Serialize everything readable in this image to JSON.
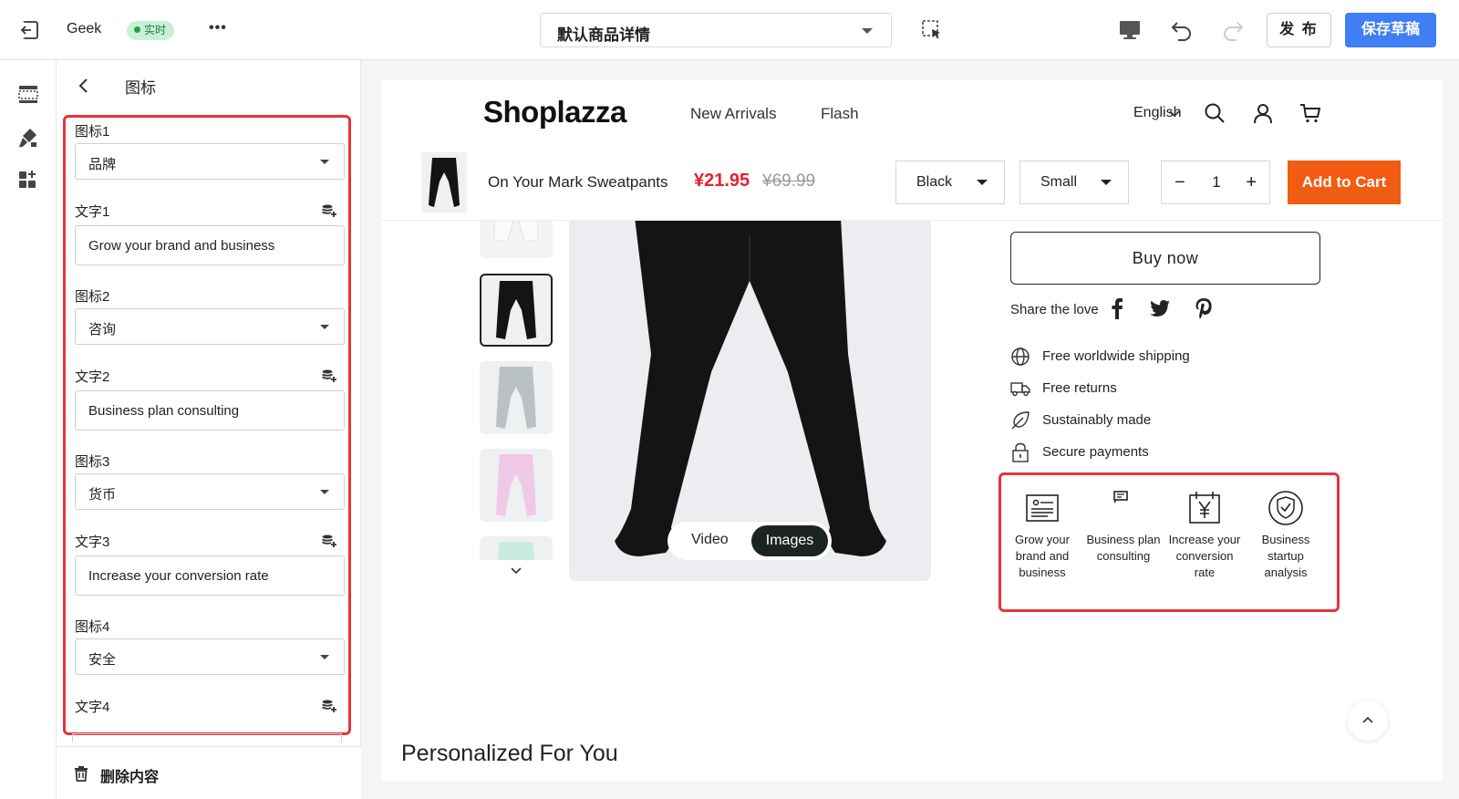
{
  "topbar": {
    "store_name": "Geek",
    "status_badge": "实时",
    "more": "•••",
    "page_select": "默认商品详情",
    "publish_label": "发 布",
    "save_label": "保存草稿"
  },
  "panel": {
    "title": "图标",
    "fields": [
      {
        "icon_label": "图标1",
        "icon_value": "品牌",
        "text_label": "文字1",
        "text_value": "Grow your brand and business"
      },
      {
        "icon_label": "图标2",
        "icon_value": "咨询",
        "text_label": "文字2",
        "text_value": "Business plan consulting"
      },
      {
        "icon_label": "图标3",
        "icon_value": "货币",
        "text_label": "文字3",
        "text_value": "Increase your conversion rate"
      },
      {
        "icon_label": "图标4",
        "icon_value": "安全",
        "text_label": "文字4"
      }
    ],
    "delete_label": "删除内容"
  },
  "preview": {
    "logo": "Shoplazza",
    "nav": [
      "New Arrivals",
      "Flash"
    ],
    "language": "English",
    "sticky": {
      "product_name": "On Your Mark Sweatpants",
      "price": "¥21.95",
      "old_price": "¥69.99",
      "color": "Black",
      "size": "Small",
      "quantity": "1",
      "minus": "−",
      "plus": "+",
      "add_to_cart": "Add to Cart"
    },
    "media_toggle": [
      "Video",
      "Images"
    ],
    "buy_now": "Buy now",
    "share_label": "Share the love",
    "features": [
      "Free worldwide shipping",
      "Free returns",
      "Sustainably made",
      "Secure payments"
    ],
    "icon_block": [
      "Grow your brand and business",
      "Business plan consulting",
      "Increase your conversion rate",
      "Business startup analysis"
    ],
    "section_title": "Personalized For You"
  },
  "colors": {
    "accent_blue": "#3f7ef5",
    "highlight_red": "#e8333a",
    "price_red": "#e8202a",
    "cart_orange": "#f25c12",
    "badge_green": "#1fa349"
  },
  "icons": {
    "topbar": [
      "exit-icon",
      "select-element-icon",
      "desktop-icon",
      "undo-icon",
      "redo-icon"
    ],
    "rail": [
      "sections-icon",
      "theme-brush-icon",
      "apps-icon"
    ],
    "header": [
      "chevron-down-icon",
      "search-icon",
      "user-icon",
      "cart-icon"
    ],
    "share": [
      "facebook-icon",
      "twitter-icon",
      "pinterest-icon"
    ],
    "features": [
      "globe-icon",
      "truck-icon",
      "leaf-icon",
      "lock-icon"
    ]
  }
}
